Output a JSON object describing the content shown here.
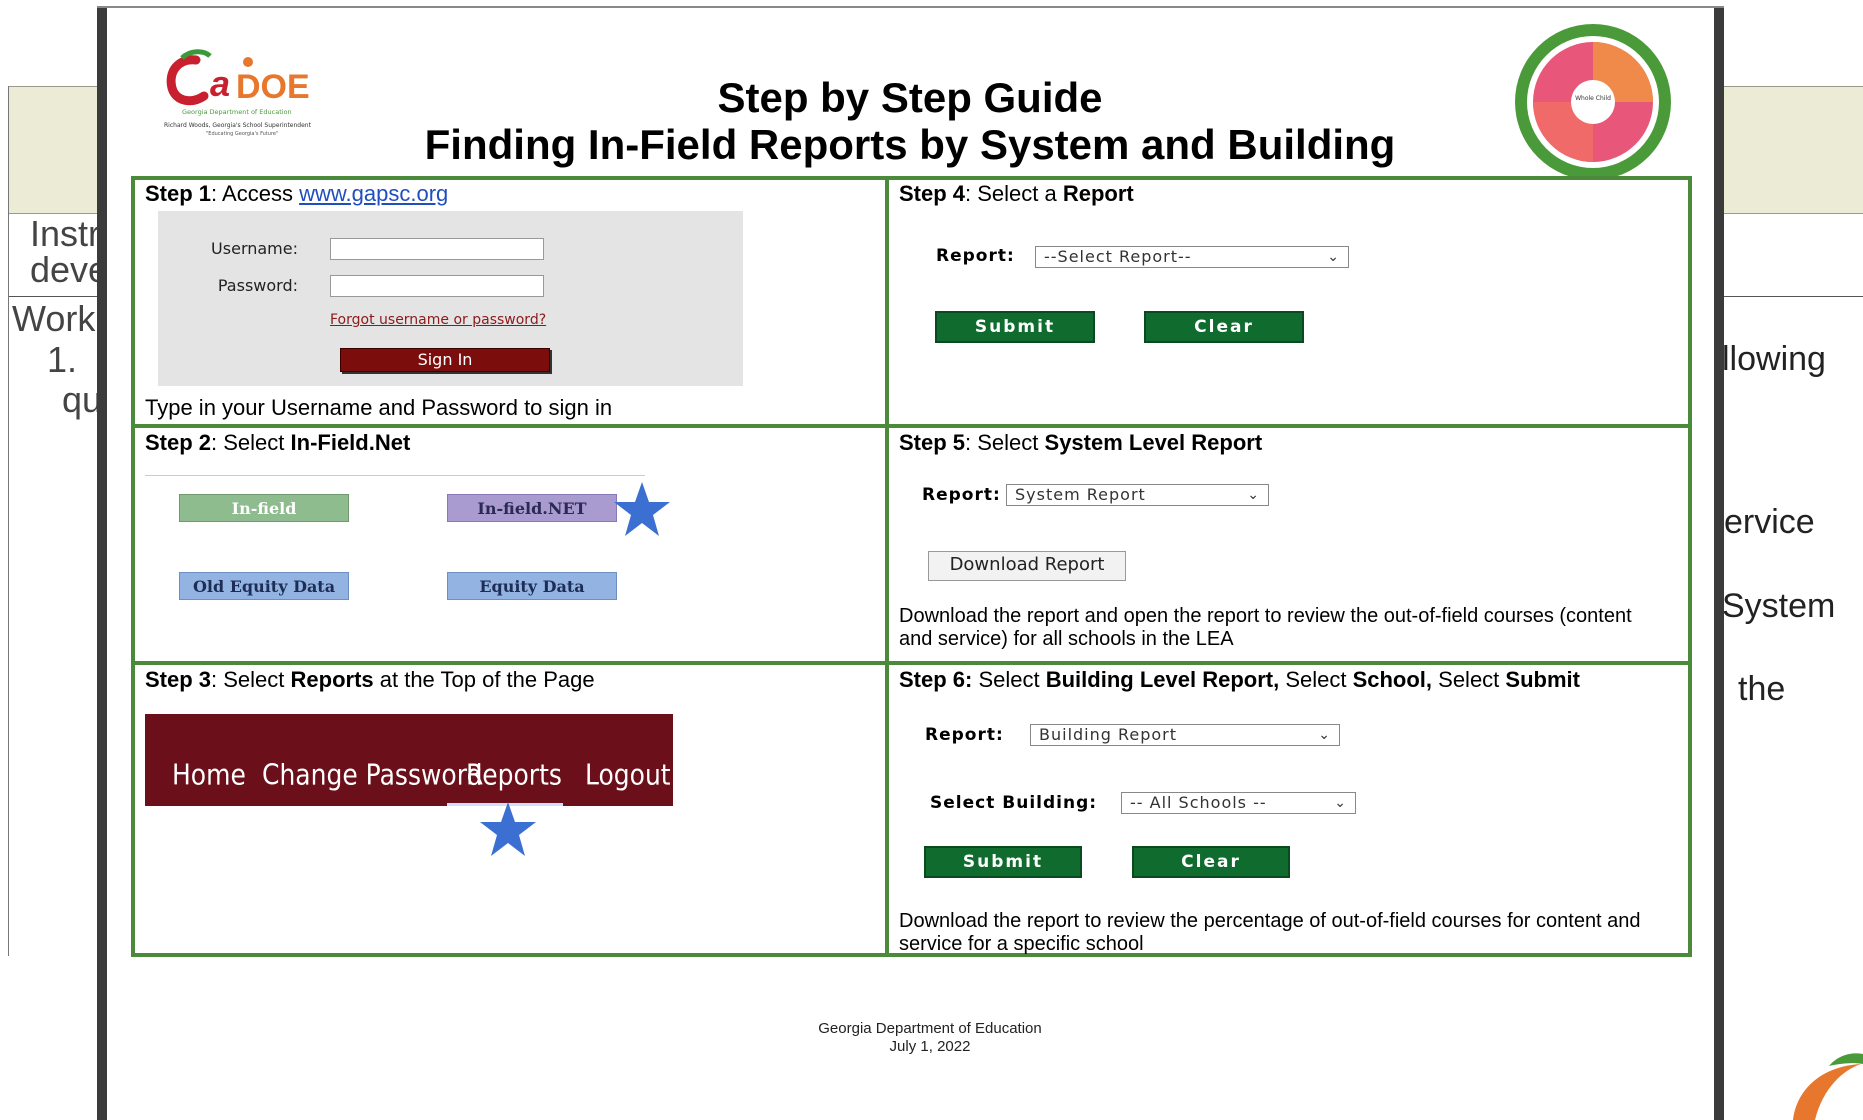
{
  "background_slide": {
    "left_lines": [
      "Instr",
      "deve",
      "Work",
      "1.",
      "qu"
    ],
    "right_lines": [
      "llowing",
      "ervice",
      "System",
      "the"
    ]
  },
  "logo": {
    "brand": "GaDOE",
    "line1": "Georgia Department of Education",
    "line2": "Richard Woods, Georgia's School Superintendent",
    "line3": "\"Educating Georgia's Future\""
  },
  "wheel": {
    "center": "Whole Child"
  },
  "header": {
    "title": "Step by Step Guide",
    "subtitle": "Finding In-Field Reports by System and Building"
  },
  "step1": {
    "label": "Step 1",
    "text": ": Access ",
    "link": "www.gapsc.org",
    "username_label": "Username:",
    "password_label": "Password:",
    "forgot": "Forgot username or password?",
    "sign_in": "Sign In",
    "caption": "Type in your Username and Password to sign in"
  },
  "step2": {
    "label": "Step 2",
    "text": ": Select ",
    "bold": "In-Field.Net",
    "tiles": [
      "In-field",
      "In-field.NET",
      "Old Equity Data",
      "Equity Data"
    ]
  },
  "step3": {
    "label": "Step 3",
    "text": ": Select ",
    "bold": "Reports",
    "text2": " at the Top of the Page",
    "nav": [
      "Home",
      "Change Password",
      "Reports",
      "Logout"
    ]
  },
  "step4": {
    "label": "Step 4",
    "text": ": Select a ",
    "bold": "Report",
    "report_label": "Report:",
    "report_value": "--Select Report--",
    "submit": "Submit",
    "clear": "Clear"
  },
  "step5": {
    "label": "Step 5",
    "text": ": Select ",
    "bold": "System Level Report",
    "report_label": "Report:",
    "report_value": "System Report",
    "download": "Download Report",
    "desc": "Download the report and open the report to review the out-of-field courses (content and service) for all schools in the LEA"
  },
  "step6": {
    "label": "Step 6:",
    "t1": " Select ",
    "b1": "Building Level Report,",
    "t2": " Select ",
    "b2": "School,",
    "t3": " Select ",
    "b3": "Submit",
    "report_label": "Report:",
    "report_value": "Building Report",
    "building_label": "Select Building:",
    "building_value": "-- All Schools --",
    "submit": "Submit",
    "clear": "Clear",
    "desc": "Download the report to review the percentage of out-of-field courses for content and service for a specific school"
  },
  "footer": {
    "org": "Georgia Department of Education",
    "date": "July 1, 2022"
  },
  "colors": {
    "grid_border": "#4a8a3a",
    "nav_bg": "#6b0f1a",
    "submit_bg": "#0f6b2e",
    "sign_in_bg": "#7b0d0d",
    "star": "#3b6fd1",
    "link": "#1f4fbf"
  }
}
